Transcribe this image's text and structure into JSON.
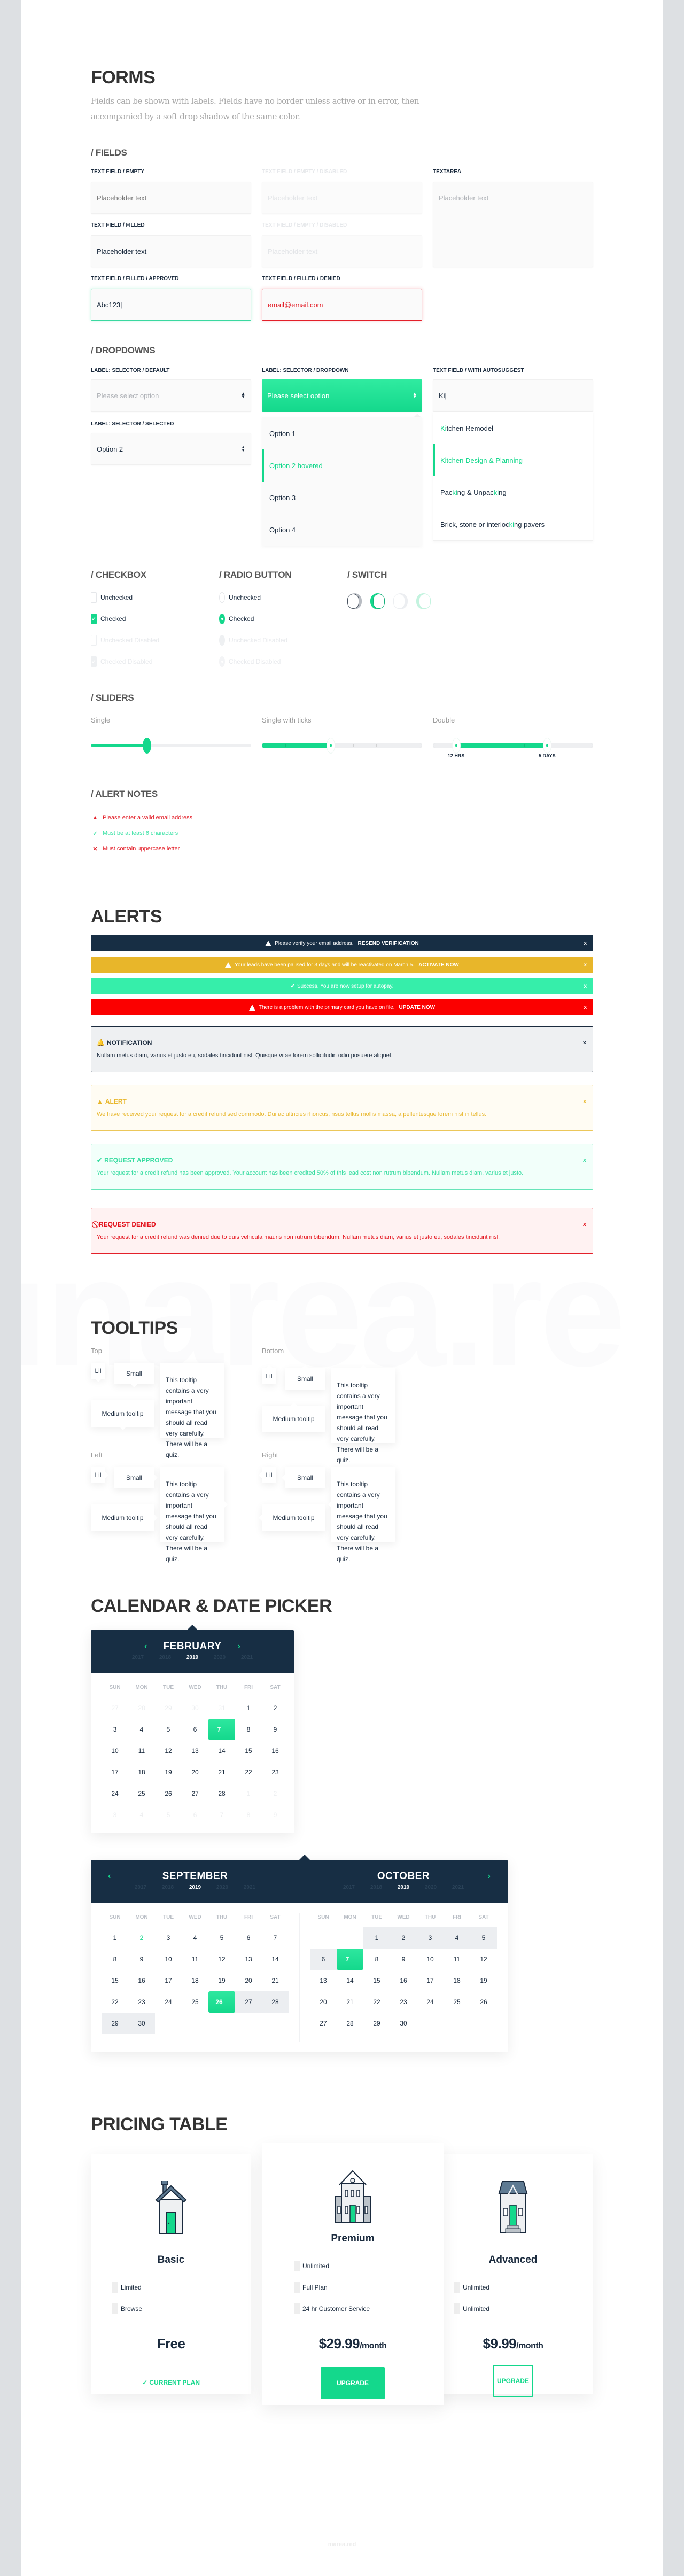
{
  "forms": {
    "title": "FORMS",
    "description": "Fields can be shown with labels. Fields have no border unless active or in error, then accompanied by a soft drop shadow of the same color.",
    "fields": {
      "heading": "/ FIELDS",
      "empty": {
        "label": "TEXT FIELD / EMPTY",
        "placeholder": "Placeholder text"
      },
      "empty_disabled": {
        "label": "TEXT FIELD / EMPTY / DISABLED",
        "placeholder": "Placeholder text"
      },
      "textarea": {
        "label": "TEXTAREA",
        "placeholder": "Placeholder text"
      },
      "filled": {
        "label": "TEXT FIELD / FILLED",
        "value": "Placeholder text"
      },
      "filled_disabled": {
        "label": "TEXT FIELD / EMPTY / DISABLED",
        "placeholder": "Placeholder text"
      },
      "approved": {
        "label": "TEXT FIELD / FILLED / APPROVED",
        "value": "Abc123|"
      },
      "denied": {
        "label": "TEXT FIELD / FILLED / DENIED",
        "value": "email@email.com"
      }
    },
    "dropdowns": {
      "heading": "/ DROPDOWNS",
      "default": {
        "label": "LABEL: SELECTOR / DEFAULT",
        "placeholder": "Please select option"
      },
      "selected": {
        "label": "LABEL: SELECTOR / SELECTED",
        "value": "Option 2"
      },
      "dropdown": {
        "label": "LABEL: SELECTOR / DROPDOWN",
        "placeholder": "Please select option",
        "options": [
          "Option 1",
          "Option 2 hovered",
          "Option 3",
          "Option 4"
        ],
        "hovered_index": 1
      },
      "autosuggest": {
        "label": "TEXT FIELD / WITH AUTOSUGGEST",
        "value": "Ki|",
        "suggestions": [
          {
            "parts": [
              {
                "t": "Ki",
                "h": true
              },
              {
                "t": "tchen Remodel",
                "h": false
              }
            ]
          },
          {
            "parts": [
              {
                "t": "Kitchen Design & Planning",
                "h": true
              }
            ],
            "hovered": true
          },
          {
            "parts": [
              {
                "t": "Pac",
                "h": false
              },
              {
                "t": "ki",
                "h": true
              },
              {
                "t": "ng & Unpac",
                "h": false
              },
              {
                "t": "ki",
                "h": true
              },
              {
                "t": "ng",
                "h": false
              }
            ]
          },
          {
            "parts": [
              {
                "t": "Brick, stone or interloc",
                "h": false
              },
              {
                "t": "ki",
                "h": true
              },
              {
                "t": "ng pavers",
                "h": false
              }
            ]
          }
        ]
      }
    },
    "checkbox": {
      "heading": "/ CHECKBOX",
      "items": [
        {
          "label": "Unchecked",
          "state": "off"
        },
        {
          "label": "Checked",
          "state": "on"
        },
        {
          "label": "Unchecked Disabled",
          "state": "dis"
        },
        {
          "label": "Checked Disabled",
          "state": "dis-on"
        }
      ]
    },
    "radio": {
      "heading": "/ RADIO BUTTON",
      "items": [
        {
          "label": "Unchecked",
          "state": "off"
        },
        {
          "label": "Checked",
          "state": "on"
        },
        {
          "label": "Unchecked Disabled",
          "state": "dis"
        },
        {
          "label": "Checked Disabled",
          "state": "dis-on"
        }
      ]
    },
    "switch": {
      "heading": "/ SWITCH",
      "items": [
        {
          "state": "off"
        },
        {
          "state": "on"
        },
        {
          "state": "off-dis"
        },
        {
          "state": "on-dis"
        }
      ]
    },
    "sliders": {
      "heading": "/ SLIDERS",
      "single": {
        "label": "Single",
        "value_pct": 35
      },
      "ticks": {
        "label": "Single with ticks",
        "steps": 7,
        "value_step": 3
      },
      "double": {
        "label": "Double",
        "steps": 7,
        "low_step": 1,
        "high_step": 5,
        "low_label": "12 HRS",
        "high_label": "5 DAYS"
      }
    },
    "alert_notes": {
      "heading": "/ ALERT NOTES",
      "items": [
        {
          "icon": "warning-icon",
          "glyph": "▲",
          "text": "Please enter a valid email address",
          "color": "#e3202a"
        },
        {
          "icon": "check-icon",
          "glyph": "✓",
          "text": "Must be at least 6 characters",
          "color": "#3de2a6"
        },
        {
          "icon": "x-icon",
          "glyph": "✕",
          "text": "Must contain uppercase letter",
          "color": "#e3202a"
        }
      ]
    }
  },
  "alerts": {
    "title": "ALERTS",
    "banners": [
      {
        "icon": "warning-icon",
        "text": "Please verify your email address.",
        "action": "RESEND VERIFICATION",
        "bg": "#172e44",
        "close": "x"
      },
      {
        "icon": "warning-icon",
        "text": "Your leads have been paused for 3 days and will be reactivated on March 5.",
        "action": "ACTIVATE NOW",
        "bg": "#e8b62a",
        "close": "x"
      },
      {
        "icon": "check-icon",
        "text": "Success. You are now setup for autopay.",
        "action": "",
        "bg": "#36eeaa",
        "close": "x"
      },
      {
        "icon": "warning-icon",
        "text": "There is a problem with the primary card you have on file.",
        "action": "UPDATE NOW",
        "bg": "#fb0000",
        "close": "x"
      }
    ],
    "boxes": [
      {
        "icon": "bell-icon",
        "glyph": "🔔",
        "title": "NOTIFICATION",
        "text": "Nullam metus diam, varius et justo eu, sodales tincidunt nisl. Quisque vitae lorem sollicitudin odio posuere aliquet.",
        "color": "#1b2b3e",
        "bg": "#eef0f2",
        "border": "#1b2b3e",
        "close": "x"
      },
      {
        "icon": "warning-icon",
        "glyph": "▲",
        "title": "ALERT",
        "text": "We have received your request for a credit refund sed commodo. Dui ac ultricies rhoncus, risus tellus mollis massa, a pellentesque lorem nisl in tellus.",
        "color": "#e8b62a",
        "bg": "#fffcf3",
        "border": "#ecc75a",
        "close": "x"
      },
      {
        "icon": "check-icon",
        "glyph": "✔",
        "title": "REQUEST APPROVED",
        "text": "Your request for a credit refund has been approved.  Your account has been credited 50% of this lead cost non rutrum bibendum. Nullam metus diam, varius et justo.",
        "color": "#36dca0",
        "bg": "#f2fffa",
        "border": "#67e4b8",
        "close": "x"
      },
      {
        "icon": "ban-icon",
        "glyph": "⃠",
        "title": "REQUEST DENIED",
        "text": "Your request for a credit refund was denied due to duis vehicula mauris non rutrum bibendum. Nullam metus diam, varius et justo eu, sodales tincidunt nisl.",
        "color": "#e3101a",
        "bg": "#fff2f2",
        "border": "#e3202a",
        "close": "x"
      }
    ]
  },
  "watermark": "marea.red",
  "tooltips": {
    "title": "TOOLTIPS",
    "groups": [
      {
        "label": "Top",
        "dir": "up"
      },
      {
        "label": "Bottom",
        "dir": "down"
      },
      {
        "label": "Left",
        "dir": "lft"
      },
      {
        "label": "Right",
        "dir": "rgt"
      }
    ],
    "lil": "Lil",
    "small": "Small",
    "medium": "Medium tooltip",
    "long": "This tooltip contains a very important message that you should all read very carefully. There will be a quiz."
  },
  "calendar": {
    "title": "CALENDAR & DATE PICKER",
    "weekdays": [
      "SUN",
      "MON",
      "TUE",
      "WED",
      "THU",
      "FRI",
      "SAT"
    ],
    "single": {
      "month": "FEBRUARY",
      "years": [
        "2017",
        "2018",
        "2019",
        "2020",
        "2021"
      ],
      "current_year": "2019",
      "days": [
        {
          "d": "27",
          "m": 1
        },
        {
          "d": "28",
          "m": 1
        },
        {
          "d": "29",
          "m": 1
        },
        {
          "d": "30",
          "m": 1
        },
        {
          "d": "31",
          "m": 1
        },
        {
          "d": "1"
        },
        {
          "d": "2"
        },
        {
          "d": "3"
        },
        {
          "d": "4"
        },
        {
          "d": "5"
        },
        {
          "d": "6"
        },
        {
          "d": "7",
          "s": 1
        },
        {
          "d": "8"
        },
        {
          "d": "9"
        },
        {
          "d": "10"
        },
        {
          "d": "11"
        },
        {
          "d": "12"
        },
        {
          "d": "13"
        },
        {
          "d": "14"
        },
        {
          "d": "15"
        },
        {
          "d": "16"
        },
        {
          "d": "17"
        },
        {
          "d": "18"
        },
        {
          "d": "19"
        },
        {
          "d": "20"
        },
        {
          "d": "21"
        },
        {
          "d": "22"
        },
        {
          "d": "23"
        },
        {
          "d": "24"
        },
        {
          "d": "25"
        },
        {
          "d": "26"
        },
        {
          "d": "27"
        },
        {
          "d": "28"
        },
        {
          "d": "1",
          "m": 1
        },
        {
          "d": "2",
          "m": 1
        },
        {
          "d": "3",
          "m": 1
        },
        {
          "d": "4",
          "m": 1
        },
        {
          "d": "5",
          "m": 1
        },
        {
          "d": "6",
          "m": 1
        },
        {
          "d": "7",
          "m": 1
        },
        {
          "d": "8",
          "m": 1
        },
        {
          "d": "9",
          "m": 1
        }
      ]
    },
    "range": [
      {
        "month": "SEPTEMBER",
        "years": [
          "2017",
          "2018",
          "2019",
          "2020",
          "2021"
        ],
        "current_year": "2019",
        "days": [
          {
            "d": "1"
          },
          {
            "d": "2",
            "t": 1
          },
          {
            "d": "3"
          },
          {
            "d": "4"
          },
          {
            "d": "5"
          },
          {
            "d": "6"
          },
          {
            "d": "7"
          },
          {
            "d": "8"
          },
          {
            "d": "9"
          },
          {
            "d": "10"
          },
          {
            "d": "11"
          },
          {
            "d": "12"
          },
          {
            "d": "13"
          },
          {
            "d": "14"
          },
          {
            "d": "15"
          },
          {
            "d": "16"
          },
          {
            "d": "17"
          },
          {
            "d": "18"
          },
          {
            "d": "19"
          },
          {
            "d": "20"
          },
          {
            "d": "21"
          },
          {
            "d": "22"
          },
          {
            "d": "23"
          },
          {
            "d": "24"
          },
          {
            "d": "25"
          },
          {
            "d": "26",
            "s": 1
          },
          {
            "d": "27",
            "r": 1
          },
          {
            "d": "28",
            "r": 1
          },
          {
            "d": "29",
            "r": 1
          },
          {
            "d": "30",
            "r": 1
          }
        ]
      },
      {
        "month": "OCTOBER",
        "years": [
          "2017",
          "2018",
          "2019",
          "2020",
          "2021"
        ],
        "current_year": "2019",
        "days": [
          {
            "d": ""
          },
          {
            "d": ""
          },
          {
            "d": "1",
            "r": 1
          },
          {
            "d": "2",
            "r": 1
          },
          {
            "d": "3",
            "r": 1
          },
          {
            "d": "4",
            "r": 1
          },
          {
            "d": "5",
            "r": 1
          },
          {
            "d": "6",
            "r": 1
          },
          {
            "d": "7",
            "s": 1
          },
          {
            "d": "8"
          },
          {
            "d": "9"
          },
          {
            "d": "10"
          },
          {
            "d": "11"
          },
          {
            "d": "12"
          },
          {
            "d": "13"
          },
          {
            "d": "14"
          },
          {
            "d": "15"
          },
          {
            "d": "16"
          },
          {
            "d": "17"
          },
          {
            "d": "18"
          },
          {
            "d": "19"
          },
          {
            "d": "20"
          },
          {
            "d": "21"
          },
          {
            "d": "22"
          },
          {
            "d": "23"
          },
          {
            "d": "24"
          },
          {
            "d": "25"
          },
          {
            "d": "26"
          },
          {
            "d": "27"
          },
          {
            "d": "28"
          },
          {
            "d": "29"
          },
          {
            "d": "30"
          }
        ]
      }
    ]
  },
  "pricing": {
    "title": "PRICING TABLE",
    "plans": [
      {
        "name": "Basic",
        "icon": "small-house-icon",
        "features": [
          "Limited",
          "Browse"
        ],
        "price": "Free",
        "per": "",
        "action": "CURRENT PLAN",
        "action_type": "current"
      },
      {
        "name": "Premium",
        "icon": "large-house-icon",
        "features": [
          "Unlimited",
          "Full Plan",
          "24 hr Customer Service"
        ],
        "price": "$29.99",
        "per": "/month",
        "action": "UPGRADE",
        "action_type": "fill"
      },
      {
        "name": "Advanced",
        "icon": "two-story-house-icon",
        "features": [
          "Unlimited",
          "Unlimited"
        ],
        "price": "$9.99",
        "per": "/month",
        "action": "UPGRADE",
        "action_type": "outline"
      }
    ]
  },
  "footer": "marea.red"
}
